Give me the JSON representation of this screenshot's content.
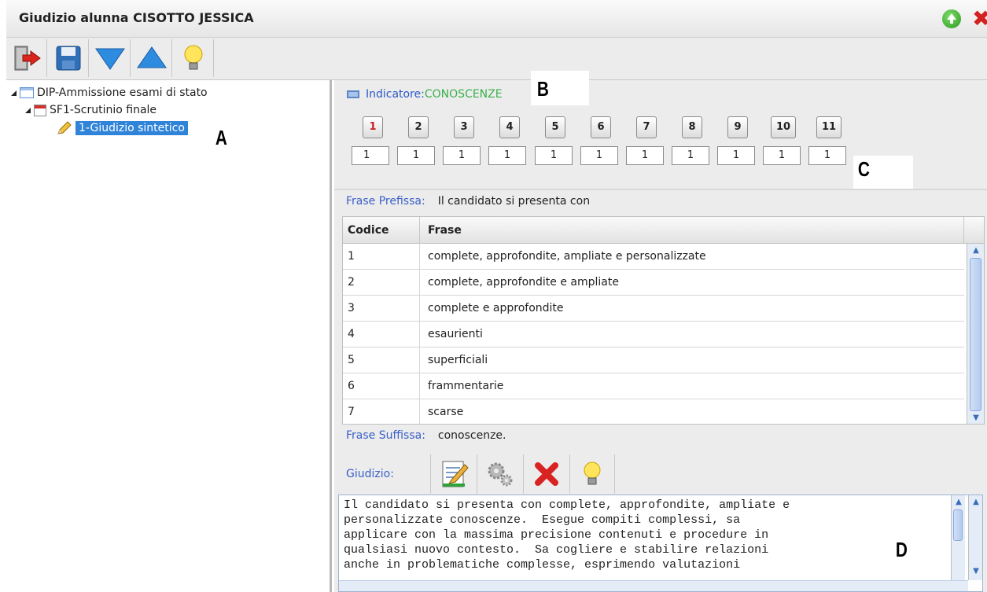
{
  "window": {
    "title": "Giudizio alunna CISOTTO JESSICA"
  },
  "toolbar": {
    "icons": [
      "exit-icon",
      "save-icon",
      "arrow-down-icon",
      "arrow-up-icon",
      "lightbulb-icon"
    ]
  },
  "tree": {
    "root": "DIP-Ammissione esami di stato",
    "child": "SF1-Scrutinio finale",
    "leaf": "1-Giudizio sintetico"
  },
  "annotations": {
    "a": "A",
    "b": "B",
    "c": "C",
    "d": "D"
  },
  "indicatore": {
    "label": "Indicatore:",
    "value": "CONOSCENZE"
  },
  "levels": {
    "buttons": [
      "1",
      "2",
      "3",
      "4",
      "5",
      "6",
      "7",
      "8",
      "9",
      "10",
      "11"
    ],
    "values": [
      "1",
      "1",
      "1",
      "1",
      "1",
      "1",
      "1",
      "1",
      "1",
      "1",
      "1"
    ]
  },
  "frase_prefissa": {
    "label": "Frase Prefissa:",
    "value": "Il candidato si presenta con"
  },
  "table": {
    "headers": [
      "Codice",
      "Frase"
    ],
    "rows": [
      {
        "codice": "1",
        "frase": "complete, approfondite, ampliate e personalizzate"
      },
      {
        "codice": "2",
        "frase": "complete, approfondite e ampliate"
      },
      {
        "codice": "3",
        "frase": "complete e approfondite"
      },
      {
        "codice": "4",
        "frase": "esaurienti"
      },
      {
        "codice": "5",
        "frase": "superficiali"
      },
      {
        "codice": "6",
        "frase": "frammentarie"
      },
      {
        "codice": "7",
        "frase": "scarse"
      }
    ]
  },
  "frase_suffissa": {
    "label": "Frase Suffissa:",
    "value": "conoscenze."
  },
  "giudizio": {
    "label": "Giudizio:",
    "text": "Il candidato si presenta con complete, approfondite, ampliate e\npersonalizzate conoscenze.  Esegue compiti complessi, sa\napplicare con la massima precisione contenuti e procedure in\nqualsiasi nuovo contesto.  Sa cogliere e stabilire relazioni\nanche in problematiche complesse, esprimendo valutazioni"
  },
  "colors": {
    "accent": "#2f83d8",
    "indicatore_value": "#38b04a",
    "label_blue": "#3a5fc8"
  }
}
